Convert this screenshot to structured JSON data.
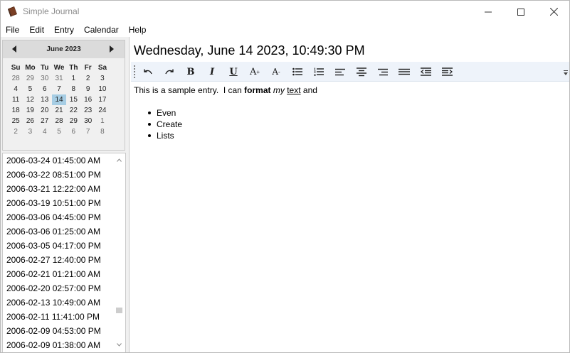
{
  "window": {
    "title": "Simple Journal"
  },
  "menu": [
    "File",
    "Edit",
    "Entry",
    "Calendar",
    "Help"
  ],
  "calendar": {
    "month_title": "June 2023",
    "days_of_week": [
      "Su",
      "Mo",
      "Tu",
      "We",
      "Th",
      "Fr",
      "Sa"
    ],
    "weeks": [
      [
        "28",
        "29",
        "30",
        "31",
        "1",
        "2",
        "3"
      ],
      [
        "4",
        "5",
        "6",
        "7",
        "8",
        "9",
        "10"
      ],
      [
        "11",
        "12",
        "13",
        "14",
        "15",
        "16",
        "17"
      ],
      [
        "18",
        "19",
        "20",
        "21",
        "22",
        "23",
        "24"
      ],
      [
        "25",
        "26",
        "27",
        "28",
        "29",
        "30",
        "1"
      ],
      [
        "2",
        "3",
        "4",
        "5",
        "6",
        "7",
        "8"
      ]
    ],
    "selected_day": "14"
  },
  "entries": [
    "2006-03-24 01:45:00 AM",
    "2006-03-22 08:51:00 PM",
    "2006-03-21 12:22:00 AM",
    "2006-03-19 10:51:00 PM",
    "2006-03-06 04:45:00 PM",
    "2006-03-06 01:25:00 AM",
    "2006-03-05 04:17:00 PM",
    "2006-02-27 12:40:00 PM",
    "2006-02-21 01:21:00 AM",
    "2006-02-20 02:57:00 PM",
    "2006-02-13 10:49:00 AM",
    "2006-02-11 11:41:00 PM",
    "2006-02-09 04:53:00 PM",
    "2006-02-09 01:38:00 AM"
  ],
  "entry_title": "Wednesday, June 14 2023, 10:49:30 PM",
  "toolbar": {
    "buttons": [
      "undo",
      "redo",
      "bold",
      "italic",
      "underline",
      "grow-font",
      "shrink-font",
      "bullets",
      "numbering",
      "align-left",
      "align-center",
      "align-right",
      "justify",
      "decrease-indent",
      "increase-indent"
    ],
    "bold_label": "B",
    "italic_label": "I",
    "underline_label": "U",
    "grow_label": "A",
    "shrink_label": "A"
  },
  "editor": {
    "text_prefix": "This is a sample entry.  I can ",
    "text_bold": "format",
    "text_italic": "my",
    "text_underline": "text",
    "text_suffix": "and",
    "list_items": [
      "Even",
      "Create",
      "Lists"
    ]
  },
  "colors": {
    "selected_day_bg": "#a6cde4",
    "toolbar_bg": "#eef3fa",
    "calendar_header_bg": "#dbdbdb"
  }
}
